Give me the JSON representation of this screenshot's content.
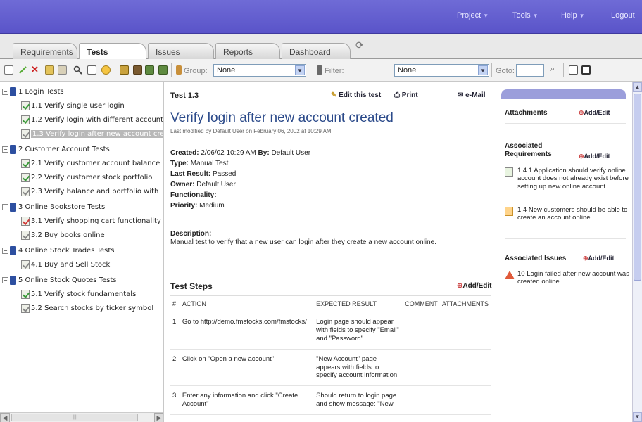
{
  "nav": {
    "project": "Project",
    "tools": "Tools",
    "help": "Help",
    "logout": "Logout"
  },
  "tabs": [
    "Requirements",
    "Tests",
    "Issues",
    "Reports",
    "Dashboard"
  ],
  "toolbar": {
    "group_label": "Group:",
    "group_value": "None",
    "filter_label": "Filter:",
    "filter_value": "None",
    "goto_label": "Goto:",
    "goto_value": ""
  },
  "tree": [
    {
      "label": "1 Login Tests"
    },
    {
      "label": "1.1 Verify single user login"
    },
    {
      "label": "1.2 Verify login with different account"
    },
    {
      "label": "1.3 Verify login after new account cre"
    },
    {
      "label": "2 Customer Account Tests"
    },
    {
      "label": "2.1 Verify customer account balance"
    },
    {
      "label": "2.2 Verify customer stock portfolio"
    },
    {
      "label": "2.3 Verify balance and portfolio with"
    },
    {
      "label": "3 Online Bookstore Tests"
    },
    {
      "label": "3.1 Verify shopping cart functionality"
    },
    {
      "label": "3.2 Buy books online"
    },
    {
      "label": "4 Online Stock Trades Tests"
    },
    {
      "label": "4.1 Buy and Sell Stock"
    },
    {
      "label": "5 Online Stock Quotes Tests"
    },
    {
      "label": "5.1 Verify stock fundamentals"
    },
    {
      "label": "5.2 Search stocks by ticker symbol"
    }
  ],
  "test": {
    "id": "Test 1.3",
    "edit": "Edit this test",
    "print": "Print",
    "email": "e-Mail",
    "title": "Verify login after new account created",
    "modified": "Last modified by Default User on February 06, 2002 at 10:29 AM",
    "created_label": "Created:",
    "created_value": "2/06/02 10:29 AM",
    "by_label": "By:",
    "by_value": "Default User",
    "type_label": "Type:",
    "type_value": "Manual Test",
    "last_result_label": "Last Result:",
    "last_result_value": "Passed",
    "owner_label": "Owner:",
    "owner_value": "Default User",
    "functionality_label": "Functionality:",
    "functionality_value": "",
    "priority_label": "Priority:",
    "priority_value": "Medium",
    "description_label": "Description:",
    "description": "Manual test to verify that a new user can login after they create a new account online."
  },
  "steps": {
    "title": "Test Steps",
    "add": "Add/Edit",
    "headers": [
      "#",
      "ACTION",
      "EXPECTED RESULT",
      "COMMENT",
      "ATTACHMENTS"
    ],
    "rows": [
      {
        "num": "1",
        "action": "Go to http://demo.fmstocks.com/fmstocks/",
        "expected": "Login page should appear with fields to specify \"Email\" and \"Password\""
      },
      {
        "num": "2",
        "action": "Click on \"Open a new account\"",
        "expected": "\"New Account\" page appears with fields to specify account information"
      },
      {
        "num": "3",
        "action": "Enter any information and click \"Create Account\"",
        "expected": "Should return to login page and show message: \"New"
      }
    ]
  },
  "sidebar": {
    "attachments_title": "Attachments",
    "attachments_add": "Add/Edit",
    "req_title": "Associated Requirements",
    "req_add": "Add/Edit",
    "requirements": [
      "1.4.1 Application should verify online account does not already exist before setting up new online account",
      "1.4 New customers should be able to create an account online."
    ],
    "issues_title": "Associated Issues",
    "issues_add": "Add/Edit",
    "issues": [
      "10 Login failed after new account was created online"
    ]
  }
}
